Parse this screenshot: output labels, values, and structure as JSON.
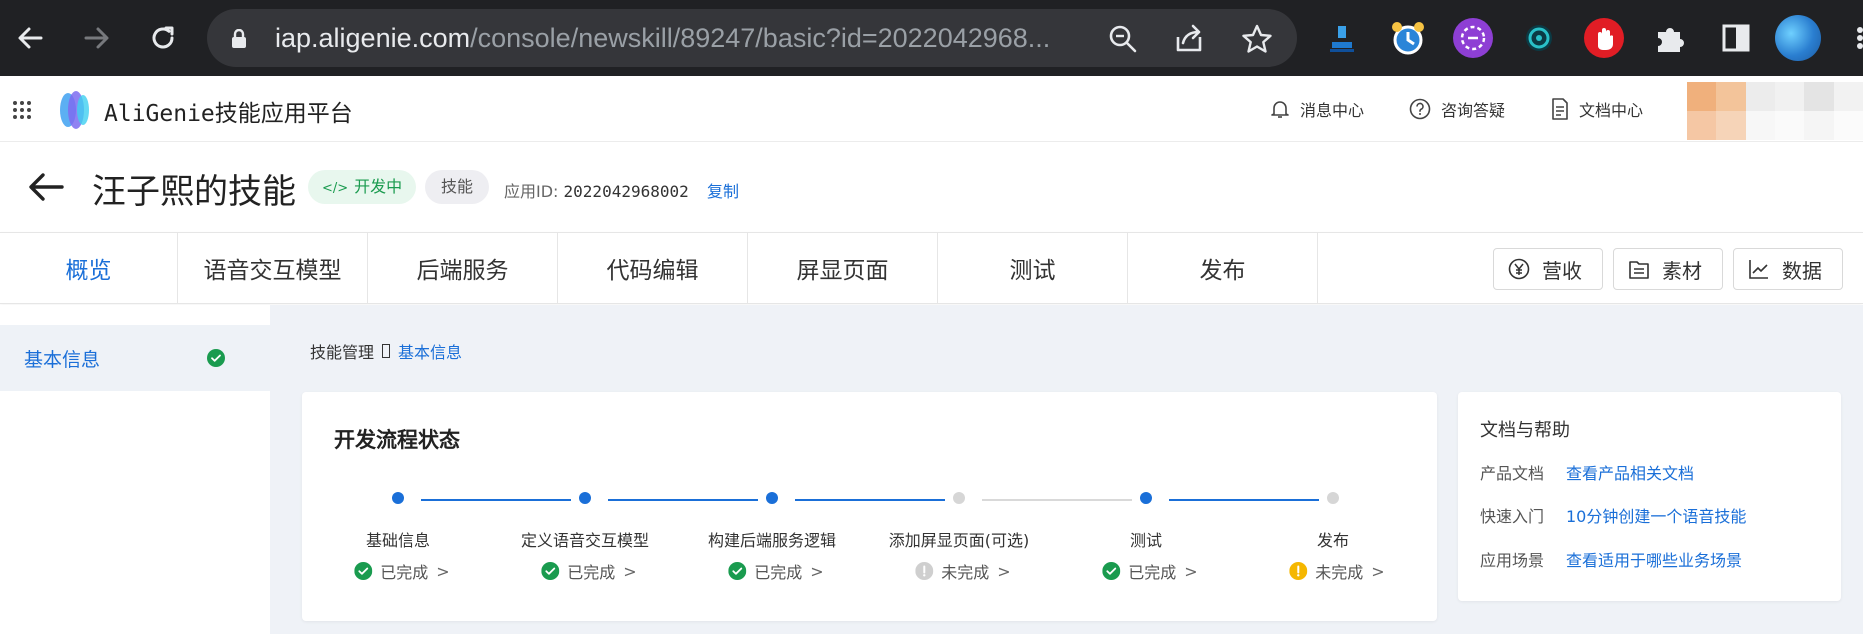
{
  "browser": {
    "url_host": "iap.aligenie.com",
    "url_path": "/console/newskill/89247/basic?id=2022042968..."
  },
  "header": {
    "brand": "AliGenie技能应用平台",
    "links": [
      {
        "label": "消息中心",
        "icon": "bell-icon"
      },
      {
        "label": "咨询答疑",
        "icon": "question-circle-icon"
      },
      {
        "label": "文档中心",
        "icon": "document-icon"
      }
    ]
  },
  "skill": {
    "title": "汪子熙的技能",
    "status_badge": "开发中",
    "type_badge": "技能",
    "app_id_label": "应用ID:",
    "app_id": "2022042968002",
    "copy_label": "复制"
  },
  "tabs": [
    {
      "label": "概览",
      "active": true
    },
    {
      "label": "语音交互模型"
    },
    {
      "label": "后端服务"
    },
    {
      "label": "代码编辑"
    },
    {
      "label": "屏显页面"
    },
    {
      "label": "测试"
    },
    {
      "label": "发布"
    }
  ],
  "tools": [
    {
      "label": "营收",
      "icon": "yen-circle-icon"
    },
    {
      "label": "素材",
      "icon": "material-icon"
    },
    {
      "label": "数据",
      "icon": "line-chart-icon"
    }
  ],
  "sidebar": {
    "items": [
      {
        "label": "基本信息",
        "status": "complete"
      }
    ]
  },
  "breadcrumb": {
    "root": "技能管理",
    "current": "基本信息"
  },
  "flow": {
    "title": "开发流程状态",
    "steps": [
      {
        "name": "基础信息",
        "status": "已完成",
        "done": true
      },
      {
        "name": "定义语音交互模型",
        "status": "已完成",
        "done": true
      },
      {
        "name": "构建后端服务逻辑",
        "status": "已完成",
        "done": true
      },
      {
        "name": "添加屏显页面(可选)",
        "status": "未完成",
        "done": false,
        "state": "gray"
      },
      {
        "name": "测试",
        "status": "已完成",
        "done": true
      },
      {
        "name": "发布",
        "status": "未完成",
        "done": false,
        "state": "warning"
      }
    ]
  },
  "help": {
    "title": "文档与帮助",
    "rows": [
      {
        "key": "产品文档",
        "link": "查看产品相关文档"
      },
      {
        "key": "快速入门",
        "link": "10分钟创建一个语音技能"
      },
      {
        "key": "应用场景",
        "link": "查看适用于哪些业务场景"
      }
    ]
  },
  "colors": {
    "accent": "#1a6fd8",
    "success": "#1a9b4f",
    "warning": "#f5b700",
    "muted": "#c8c8c8"
  }
}
